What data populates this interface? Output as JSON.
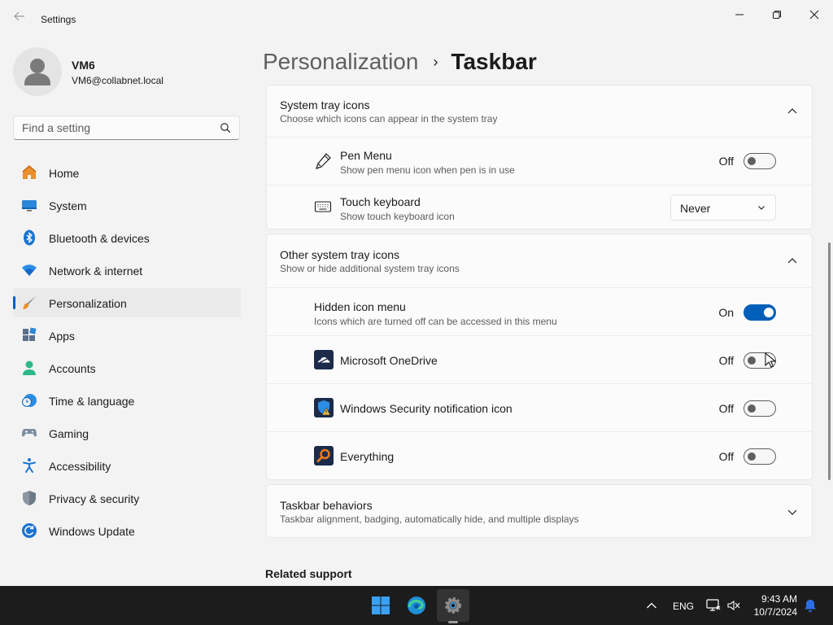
{
  "window": {
    "title": "Settings",
    "controls": [
      "minimize",
      "restore",
      "close"
    ]
  },
  "profile": {
    "name": "VM6",
    "email": "VM6@collabnet.local"
  },
  "search": {
    "placeholder": "Find a setting"
  },
  "sidebar": {
    "items": [
      {
        "label": "Home",
        "icon": "home-icon"
      },
      {
        "label": "System",
        "icon": "system-icon"
      },
      {
        "label": "Bluetooth & devices",
        "icon": "bluetooth-icon"
      },
      {
        "label": "Network & internet",
        "icon": "wifi-icon"
      },
      {
        "label": "Personalization",
        "icon": "brush-icon",
        "selected": true
      },
      {
        "label": "Apps",
        "icon": "apps-icon"
      },
      {
        "label": "Accounts",
        "icon": "accounts-icon"
      },
      {
        "label": "Time & language",
        "icon": "clock-globe-icon"
      },
      {
        "label": "Gaming",
        "icon": "gamepad-icon"
      },
      {
        "label": "Accessibility",
        "icon": "accessibility-icon"
      },
      {
        "label": "Privacy & security",
        "icon": "shield-icon"
      },
      {
        "label": "Windows Update",
        "icon": "update-icon"
      }
    ]
  },
  "breadcrumb": {
    "parent": "Personalization",
    "separator": "›",
    "current": "Taskbar"
  },
  "system_tray": {
    "title": "System tray icons",
    "subtitle": "Choose which icons can appear in the system tray",
    "pen_menu": {
      "title": "Pen Menu",
      "subtitle": "Show pen menu icon when pen is in use",
      "state": "Off",
      "on": false
    },
    "touch_keyboard": {
      "title": "Touch keyboard",
      "subtitle": "Show touch keyboard icon",
      "value": "Never"
    }
  },
  "other_tray": {
    "title": "Other system tray icons",
    "subtitle": "Show or hide additional system tray icons",
    "hidden_menu": {
      "title": "Hidden icon menu",
      "subtitle": "Icons which are turned off can be accessed in this menu",
      "state": "On",
      "on": true
    },
    "onedrive": {
      "title": "Microsoft OneDrive",
      "state": "Off",
      "on": false
    },
    "security": {
      "title": "Windows Security notification icon",
      "state": "Off",
      "on": false
    },
    "everything": {
      "title": "Everything",
      "state": "Off",
      "on": false
    }
  },
  "taskbar_behaviors": {
    "title": "Taskbar behaviors",
    "subtitle": "Taskbar alignment, badging, automatically hide, and multiple displays"
  },
  "related": {
    "title": "Related support"
  },
  "taskbar": {
    "apps": [
      "start-icon",
      "edge-icon",
      "settings-icon"
    ],
    "language": "ENG",
    "time": "9:43 AM",
    "date": "10/7/2024"
  },
  "colors": {
    "accent": "#005fb8",
    "background": "#f3f3f3",
    "card": "#fbfbfb",
    "taskbar": "#1c1c1c"
  }
}
